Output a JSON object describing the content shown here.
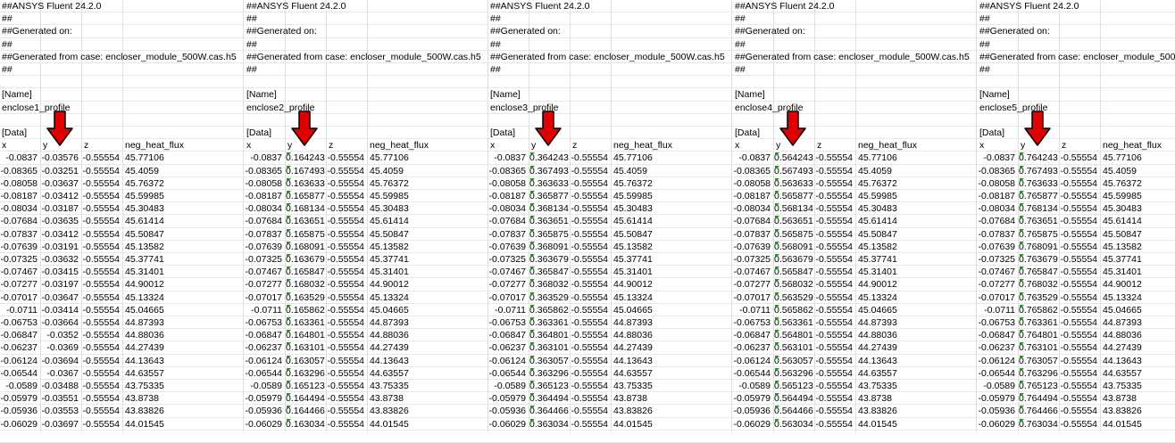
{
  "sheet": {
    "header_lines": [
      "##ANSYS Fluent 24.2.0",
      "##",
      "##Generated on:",
      "##",
      "##Generated from case: encloser_module_500W.cas.h5",
      "##"
    ],
    "name_tag": "[Name]",
    "data_tag": "[Data]",
    "columns": [
      "x",
      "y",
      "z",
      "neg_heat_flux"
    ],
    "x_values": [
      "-0.0837",
      "-0.08365",
      "-0.08058",
      "-0.08187",
      "-0.08034",
      "-0.07684",
      "-0.07837",
      "-0.07639",
      "-0.07325",
      "-0.07467",
      "-0.07277",
      "-0.07017",
      "-0.0711",
      "-0.06753",
      "-0.06847",
      "-0.06237",
      "-0.06124",
      "-0.06544",
      "-0.0589",
      "-0.05979",
      "-0.05936",
      "-0.06029"
    ],
    "z_values": [
      "-0.55554",
      "-0.55554",
      "-0.55554",
      "-0.55554",
      "-0.55554",
      "-0.55554",
      "-0.55554",
      "-0.55554",
      "-0.55554",
      "-0.55554",
      "-0.55554",
      "-0.55554",
      "-0.55554",
      "-0.55554",
      "-0.55554",
      "-0.55554",
      "-0.55554",
      "-0.55554",
      "-0.55554",
      "-0.55554",
      "-0.55554",
      "-0.55554"
    ],
    "flux_values": [
      "45.77106",
      "45.4059",
      "45.76372",
      "45.59985",
      "45.30483",
      "45.61414",
      "45.50847",
      "45.13582",
      "45.37741",
      "45.31401",
      "44.90012",
      "45.13324",
      "45.04665",
      "44.87393",
      "44.88036",
      "44.27439",
      "44.13643",
      "44.63557",
      "43.75335",
      "43.8738",
      "43.83826",
      "44.01545"
    ],
    "blocks": [
      {
        "profile": "enclose1_profile",
        "y_values": [
          "-0.03576",
          "-0.03251",
          "-0.03637",
          "-0.03412",
          "-0.03187",
          "-0.03635",
          "-0.03412",
          "-0.03191",
          "-0.03632",
          "-0.03415",
          "-0.03197",
          "-0.03647",
          "-0.03414",
          "-0.03664",
          "-0.0352",
          "-0.0369",
          "-0.03694",
          "-0.0367",
          "-0.03488",
          "-0.03551",
          "-0.03553",
          "-0.03697"
        ]
      },
      {
        "profile": "enclose2_profile",
        "y_values": [
          "0.164243",
          "0.167493",
          "0.163633",
          "0.165877",
          "0.168134",
          "0.163651",
          "0.165875",
          "0.168091",
          "0.163679",
          "0.165847",
          "0.168032",
          "0.163529",
          "0.165862",
          "0.163361",
          "0.164801",
          "0.163101",
          "0.163057",
          "0.163296",
          "0.165123",
          "0.164494",
          "0.164466",
          "0.163034"
        ]
      },
      {
        "profile": "enclose3_profile",
        "y_values": [
          "0.364243",
          "0.367493",
          "0.363633",
          "0.365877",
          "0.368134",
          "0.363651",
          "0.365875",
          "0.368091",
          "0.363679",
          "0.365847",
          "0.368032",
          "0.363529",
          "0.365862",
          "0.363361",
          "0.364801",
          "0.363101",
          "0.363057",
          "0.363296",
          "0.365123",
          "0.364494",
          "0.364466",
          "0.363034"
        ]
      },
      {
        "profile": "enclose4_profile",
        "y_values": [
          "0.564243",
          "0.567493",
          "0.563633",
          "0.565877",
          "0.568134",
          "0.563651",
          "0.565875",
          "0.568091",
          "0.563679",
          "0.565847",
          "0.568032",
          "0.563529",
          "0.565862",
          "0.563361",
          "0.564801",
          "0.563101",
          "0.563057",
          "0.563296",
          "0.565123",
          "0.564494",
          "0.564466",
          "0.563034"
        ]
      },
      {
        "profile": "enclose5_profile",
        "y_values": [
          "0.764243",
          "0.767493",
          "0.763633",
          "0.765877",
          "0.768134",
          "0.763651",
          "0.765875",
          "0.768091",
          "0.763679",
          "0.765847",
          "0.768032",
          "0.763529",
          "0.765862",
          "0.763361",
          "0.764801",
          "0.763101",
          "0.763057",
          "0.763296",
          "0.765123",
          "0.764494",
          "0.764466",
          "0.763034"
        ]
      }
    ],
    "arrow_icon": "down-arrow-icon",
    "arrow_color": "#e00000",
    "note_marker_color": "#2e8b2e"
  }
}
